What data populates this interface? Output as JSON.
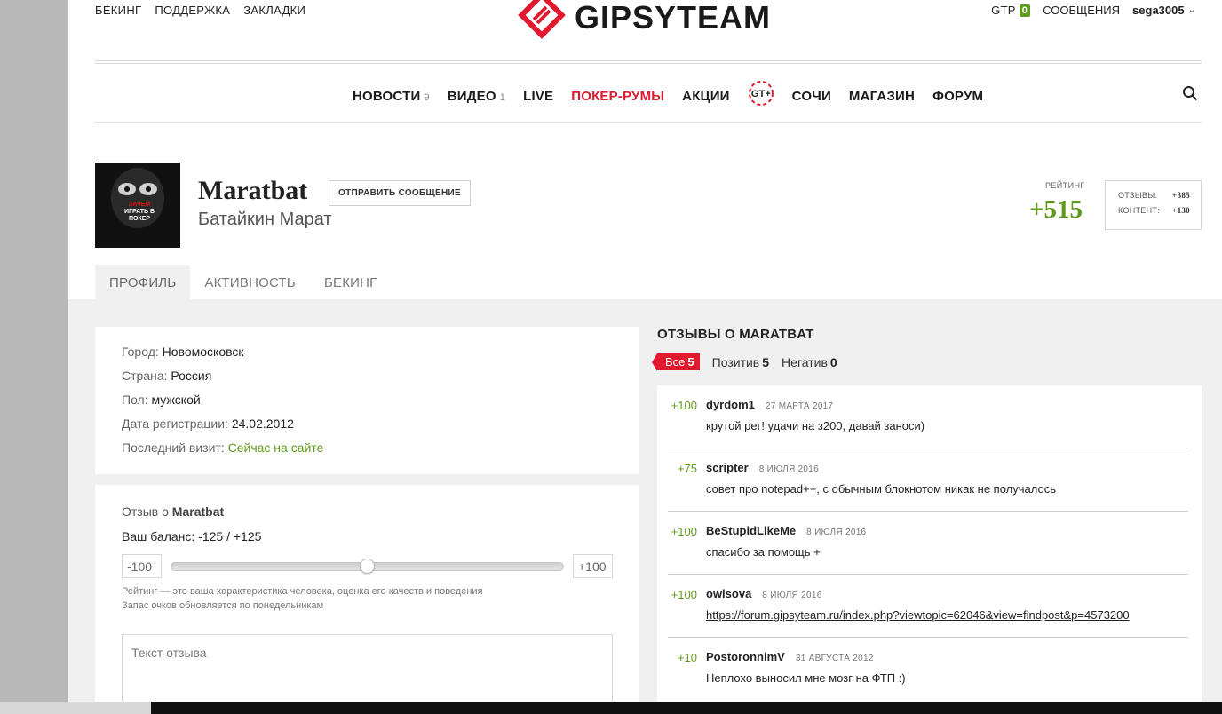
{
  "top_links": [
    "БЕКИНГ",
    "ПОДДЕРЖКА",
    "ЗАКЛАДКИ"
  ],
  "logo_text": "GIPSYTEAM",
  "top_right": {
    "gtp_label": "GTP",
    "gtp_count": "0",
    "messages": "СООБЩЕНИЯ",
    "username": "sega3005"
  },
  "nav": [
    {
      "label": "НОВОСТИ",
      "count": "9"
    },
    {
      "label": "ВИДЕО",
      "count": "1"
    },
    {
      "label": "LIVE",
      "count": ""
    },
    {
      "label": "ПОКЕР-РУМЫ",
      "count": ""
    },
    {
      "label": "АКЦИИ",
      "count": ""
    },
    {
      "label": "СОЧИ",
      "count": ""
    },
    {
      "label": "МАГАЗИН",
      "count": ""
    },
    {
      "label": "ФОРУМ",
      "count": ""
    }
  ],
  "gt_logo_text": "GT+",
  "profile": {
    "username": "Maratbat",
    "realname": "Батайкин Марат",
    "send_message": "ОТПРАВИТЬ СООБЩЕНИЕ",
    "avatar_text": [
      "ЗАЧЕМ",
      "ИГРАТЬ В",
      "ПОКЕР"
    ],
    "rating_label": "РЕЙТИНГ",
    "rating_value": "+515",
    "rating_reviews_label": "ОТЗЫВЫ:",
    "rating_reviews_value": "+385",
    "rating_content_label": "КОНТЕНТ:",
    "rating_content_value": "+130"
  },
  "tabs": [
    "ПРОФИЛЬ",
    "АКТИВНОСТЬ",
    "БЕКИНГ"
  ],
  "info": [
    {
      "label": "Город:",
      "value": "Новомосковск"
    },
    {
      "label": "Страна:",
      "value": "Россия"
    },
    {
      "label": "Пол:",
      "value": "мужской"
    },
    {
      "label": "Дата регистрации:",
      "value": "24.02.2012"
    },
    {
      "label": "Последний визит:",
      "value": "Сейчас на сайте"
    }
  ],
  "review_form": {
    "title_prefix": "Отзыв о",
    "title_name": "Maratbat",
    "balance": "Ваш баланс: -125 / +125",
    "min": "-100",
    "max": "+100",
    "slider_value": 0,
    "hint1": "Рейтинг — это ваша характеристика человека, оценка его качеств и поведения",
    "hint2": "Запас очков обновляется по понедельникам",
    "placeholder": "Текст отзыва"
  },
  "reviews_header": "ОТЗЫВЫ О MARATBAT",
  "filters": {
    "all": "Все",
    "all_count": "5",
    "pos": "Позитив",
    "pos_count": "5",
    "neg": "Негатив",
    "neg_count": "0"
  },
  "reviews": [
    {
      "score": "+100",
      "author": "dyrdom1",
      "date": "27 МАРТА 2017",
      "text": "крутой рег! удачи на з200, давай заноси)",
      "link": false
    },
    {
      "score": "+75",
      "author": "scripter",
      "date": "8 ИЮЛЯ 2016",
      "text": "совет про notepad++, с обычным блокнотом никак не получалось",
      "link": false
    },
    {
      "score": "+100",
      "author": "BeStupidLikeMe",
      "date": "8 ИЮЛЯ 2016",
      "text": "спасибо за помощь +",
      "link": false
    },
    {
      "score": "+100",
      "author": "owlsova",
      "date": "8 ИЮЛЯ 2016",
      "text": "https://forum.gipsyteam.ru/index.php?viewtopic=62046&view=findpost&p=4573200",
      "link": true
    },
    {
      "score": "+10",
      "author": "PostoronnimV",
      "date": "31 АВГУСТА 2012",
      "text": "Неплохо выносил мне мозг на ФТП :)",
      "link": false
    }
  ],
  "colors": {
    "accent_red": "#e0192e",
    "green": "#5f9b1b"
  }
}
